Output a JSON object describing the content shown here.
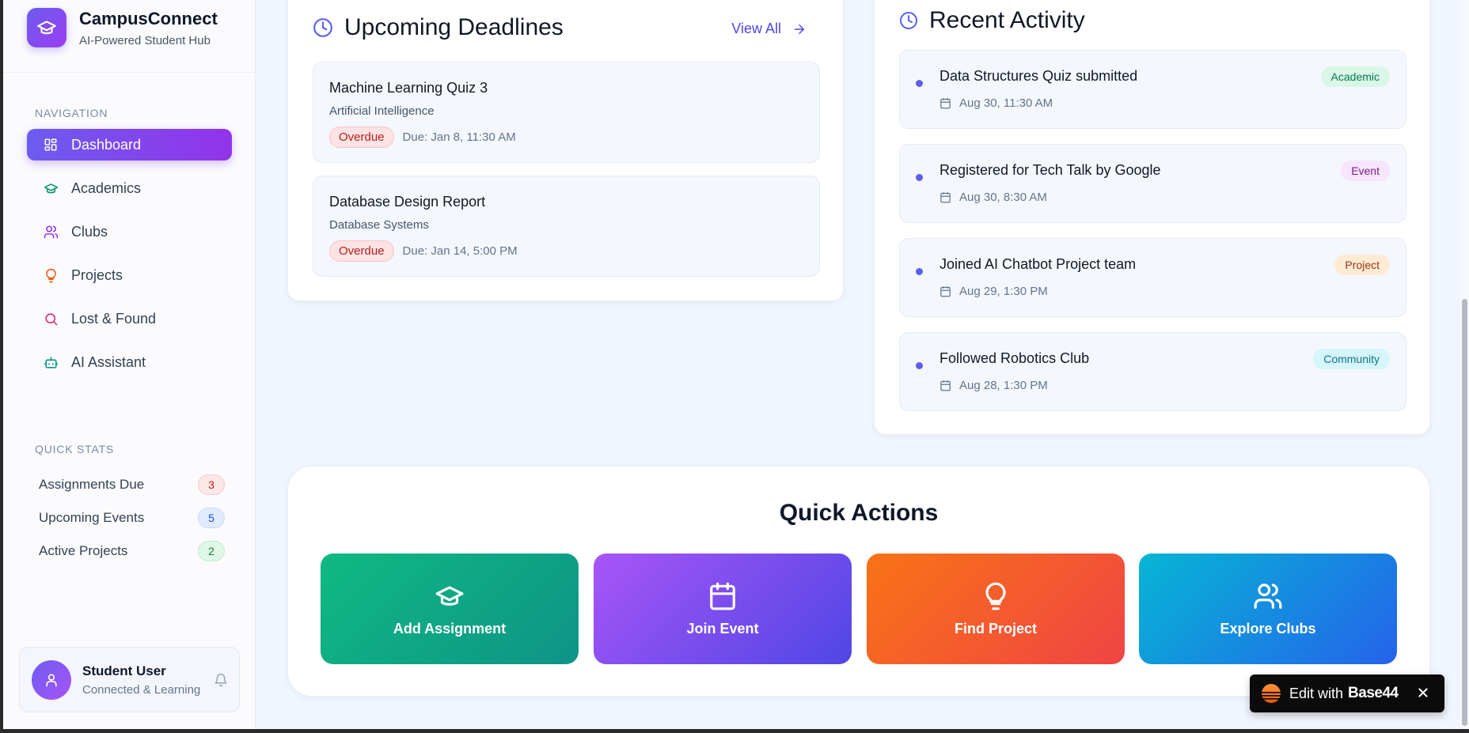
{
  "brand": {
    "name": "CampusConnect",
    "tagline": "AI-Powered Student Hub"
  },
  "navigation": {
    "label": "NAVIGATION",
    "items": [
      {
        "label": "Dashboard",
        "icon": "dashboard-grid-icon",
        "active": true
      },
      {
        "label": "Academics",
        "icon": "graduation-cap-icon",
        "color": "#059669"
      },
      {
        "label": "Clubs",
        "icon": "users-icon",
        "color": "#9333ea"
      },
      {
        "label": "Projects",
        "icon": "lightbulb-icon",
        "color": "#ea580c"
      },
      {
        "label": "Lost & Found",
        "icon": "search-icon",
        "color": "#db2777"
      },
      {
        "label": "AI Assistant",
        "icon": "bot-icon",
        "color": "#0d9488"
      }
    ]
  },
  "quick_stats": {
    "label": "QUICK STATS",
    "items": [
      {
        "label": "Assignments Due",
        "value": "3"
      },
      {
        "label": "Upcoming Events",
        "value": "5"
      },
      {
        "label": "Active Projects",
        "value": "2"
      }
    ]
  },
  "user": {
    "name": "Student User",
    "status": "Connected & Learning"
  },
  "deadlines": {
    "title": "Upcoming Deadlines",
    "view_all": "View All",
    "items": [
      {
        "title": "Machine Learning Quiz 3",
        "course": "Artificial Intelligence",
        "status": "Overdue",
        "due": "Due: Jan 8, 11:30 AM"
      },
      {
        "title": "Database Design Report",
        "course": "Database Systems",
        "status": "Overdue",
        "due": "Due: Jan 14, 5:00 PM"
      }
    ]
  },
  "activity": {
    "title": "Recent Activity",
    "items": [
      {
        "title": "Data Structures Quiz submitted",
        "time": "Aug 30, 11:30 AM",
        "tag": "Academic"
      },
      {
        "title": "Registered for Tech Talk by Google",
        "time": "Aug 30, 8:30 AM",
        "tag": "Event"
      },
      {
        "title": "Joined AI Chatbot Project team",
        "time": "Aug 29, 1:30 PM",
        "tag": "Project"
      },
      {
        "title": "Followed Robotics Club",
        "time": "Aug 28, 1:30 PM",
        "tag": "Community"
      }
    ]
  },
  "quick_actions": {
    "title": "Quick Actions",
    "items": [
      {
        "label": "Add Assignment",
        "icon": "graduation-cap-icon"
      },
      {
        "label": "Join Event",
        "icon": "calendar-icon"
      },
      {
        "label": "Find Project",
        "icon": "lightbulb-icon"
      },
      {
        "label": "Explore Clubs",
        "icon": "users-icon"
      }
    ]
  },
  "edit_badge": {
    "text": "Edit with",
    "brand": "Base44"
  },
  "colors": {
    "accent": "#6d5cf0",
    "accent_purple": "#9333ea",
    "overdue": "#b91c1c"
  }
}
